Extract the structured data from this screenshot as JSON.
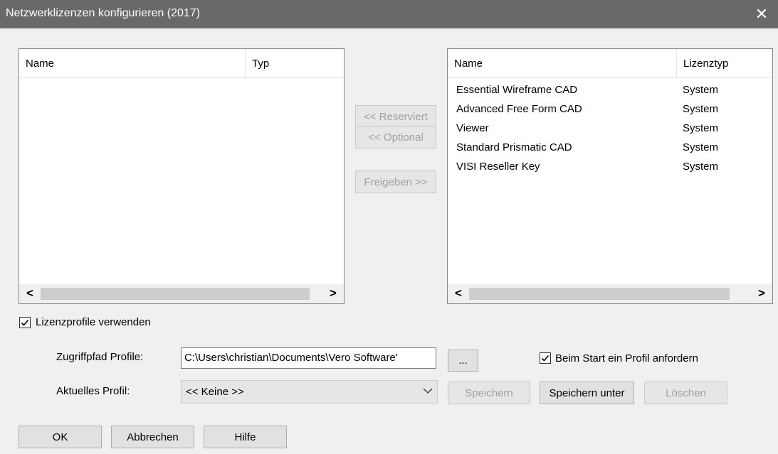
{
  "window": {
    "title": "Netzwerklizenzen konfigurieren (2017)",
    "close_glyph": "✕"
  },
  "left_list": {
    "columns": [
      "Name",
      "Typ"
    ],
    "rows": []
  },
  "right_list": {
    "columns": [
      "Name",
      "Lizenztyp"
    ],
    "rows": [
      {
        "name": "Essential Wireframe CAD",
        "type": "System"
      },
      {
        "name": "Advanced Free Form CAD",
        "type": "System"
      },
      {
        "name": "Viewer",
        "type": "System"
      },
      {
        "name": "Standard Prismatic CAD",
        "type": "System"
      },
      {
        "name": "VISI Reseller Key",
        "type": "System"
      }
    ]
  },
  "transfer_buttons": {
    "reserved": "<< Reserviert",
    "optional": "<< Optional",
    "release": "Freigeben >>"
  },
  "profiles": {
    "use_profiles_label": "Lizenzprofile verwenden",
    "use_profiles_checked": true,
    "path_label": "Zugriffpfad Profile:",
    "path_value": "C:\\Users\\christian\\Documents\\Vero Software'",
    "browse_label": "...",
    "request_on_start_label": "Beim Start ein Profil anfordern",
    "request_on_start_checked": true,
    "current_label": "Aktuelles Profil:",
    "current_value": "<< Keine >>",
    "save_label": "Speichern",
    "save_as_label": "Speichern unter",
    "delete_label": "Löschen"
  },
  "footer": {
    "ok": "OK",
    "cancel": "Abbrechen",
    "help": "Hilfe"
  },
  "scroll": {
    "left_glyph": "<",
    "right_glyph": ">"
  },
  "icons": {
    "checkbox_check": "checkmark-icon",
    "dropdown": "chevron-down-icon",
    "close": "close-icon"
  }
}
